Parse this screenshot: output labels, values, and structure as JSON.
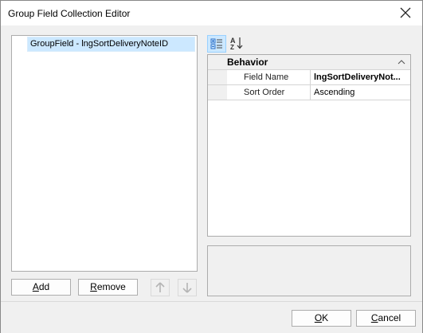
{
  "window": {
    "title": "Group Field Collection Editor",
    "close_icon": "close-icon"
  },
  "members": {
    "items": [
      {
        "label": "GroupField - lngSortDeliveryNoteID",
        "selected": true
      }
    ]
  },
  "member_buttons": {
    "add_label": "Add",
    "add_mnemonic": "A",
    "add_rest": "dd",
    "remove_label": "Remove",
    "remove_mnemonic": "R",
    "remove_rest": "emove",
    "move_up_icon": "arrow-up-icon",
    "move_down_icon": "arrow-down-icon"
  },
  "property_toolbar": {
    "categorized_icon": "categorized-icon",
    "alphabetical_icon": "alphabetical-sort-icon"
  },
  "property_grid": {
    "category": "Behavior",
    "rows": [
      {
        "name": "Field Name",
        "value": "lngSortDeliveryNot...",
        "bold": true
      },
      {
        "name": "Sort Order",
        "value": "Ascending",
        "bold": false
      }
    ]
  },
  "footer": {
    "ok_label": "OK",
    "ok_mnemonic": "O",
    "ok_rest": "K",
    "cancel_label": "Cancel",
    "cancel_mnemonic": "C",
    "cancel_rest": "ancel"
  },
  "colors": {
    "selection": "#cce8ff",
    "accent_blue": "#2b6fc9"
  }
}
